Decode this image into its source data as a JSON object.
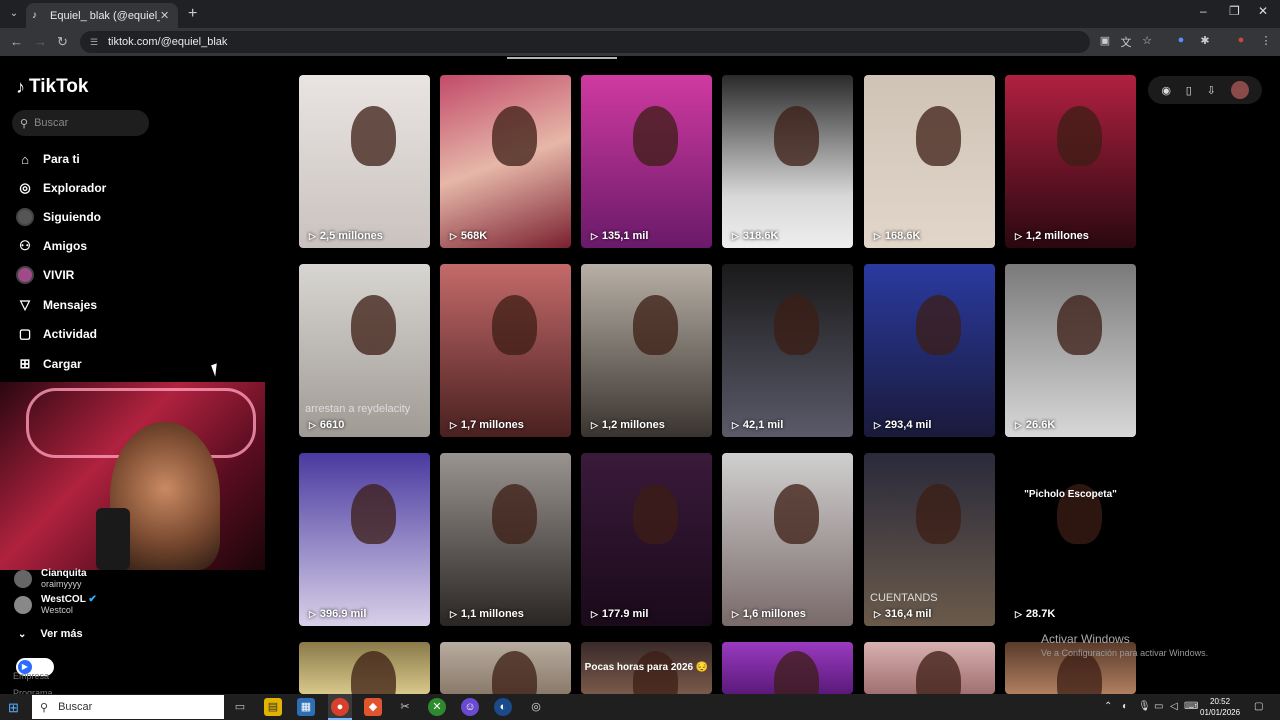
{
  "browser": {
    "tab_title": "Equiel_ blak (@equiel_.blak) | Ti",
    "url": "tiktok.com/@equiel_blak",
    "new_tab": "+",
    "tab_close": "✕",
    "win_minimize": "–",
    "win_restore": "❐",
    "win_close": "✕"
  },
  "sidebar": {
    "logo": "TikTok",
    "search_placeholder": "Buscar",
    "menu": [
      {
        "label": "Para ti",
        "icon": "home-icon"
      },
      {
        "label": "Explorador",
        "icon": "compass-icon"
      },
      {
        "label": "Siguiendo",
        "icon": "following-avatar"
      },
      {
        "label": "Amigos",
        "icon": "friends-icon"
      },
      {
        "label": "VIVIR",
        "icon": "live-avatar"
      },
      {
        "label": "Mensajes",
        "icon": "send-icon"
      },
      {
        "label": "Actividad",
        "icon": "activity-icon"
      },
      {
        "label": "Cargar",
        "icon": "upload-icon"
      }
    ],
    "following": [
      {
        "name": "Cianquita",
        "handle": "oraimyyyy"
      },
      {
        "name": "WestCOL",
        "handle": "Westcol"
      }
    ],
    "ver_mas": "Ver más",
    "footer_1": "Empresa",
    "footer_2": "Programa"
  },
  "grid": {
    "rows": [
      [
        {
          "views": "2,5 millones",
          "bg": "linear-gradient(180deg,#e9e4e2,#c9c2bf)"
        },
        {
          "views": "568K",
          "bg": "linear-gradient(160deg,#c24a6a,#e6b7a8,#7a2030)"
        },
        {
          "views": "135,1 mil",
          "bg": "linear-gradient(180deg,#d03aa0,#6a1a6a)"
        },
        {
          "views": "318.6K",
          "bg": "linear-gradient(180deg,#2a2a2a,#d8d8d8 70%,#eee)"
        },
        {
          "views": "168.6K",
          "bg": "linear-gradient(180deg,#cfc3b6,#e2d6cb)"
        },
        {
          "views": "1,2 millones",
          "bg": "linear-gradient(180deg,#b02040,#2a0810)"
        }
      ],
      [
        {
          "views": "6610",
          "bg": "linear-gradient(180deg,#d8d6d2,#a09a94)",
          "overlay": "arrestan a reydelacity"
        },
        {
          "views": "1,7 millones",
          "bg": "linear-gradient(180deg,#c46a6a,#4a2020)"
        },
        {
          "views": "1,2 millones",
          "bg": "linear-gradient(180deg,#b8b0a6,#3a3430)"
        },
        {
          "views": "42,1 mil",
          "bg": "linear-gradient(180deg,#1a1a1a,#5a5a6a)"
        },
        {
          "views": "293,4 mil",
          "bg": "linear-gradient(180deg,#2a3aa0,#1a1a3a)"
        },
        {
          "views": "26.6K",
          "bg": "linear-gradient(180deg,#7a7a7a,#d8d8d8)"
        }
      ],
      [
        {
          "views": "396.9 mil",
          "bg": "linear-gradient(180deg,#4a3aa0,#d8d0e8)"
        },
        {
          "views": "1,1 millones",
          "bg": "linear-gradient(180deg,#9a9490,#2a2624)"
        },
        {
          "views": "177.9 mil",
          "bg": "linear-gradient(180deg,#3a1a3a,#1a0a1a)"
        },
        {
          "views": "1,6 millones",
          "bg": "linear-gradient(180deg,#d0cfcf,#7a6a6a)"
        },
        {
          "views": "316,4 mil",
          "bg": "linear-gradient(180deg,#2a2a3a,#6a5a4a)",
          "overlay": "CUENTANDS"
        },
        {
          "views": "28.7K",
          "bg": "#000",
          "caption": "\"Picholo Escopeta\""
        }
      ],
      [
        {
          "views": "",
          "bg": "linear-gradient(180deg,#8a7a4a,#d8c88a)"
        },
        {
          "views": "",
          "bg": "linear-gradient(180deg,#b8aca0,#8a7a6a)"
        },
        {
          "views": "",
          "bg": "linear-gradient(180deg,#3a2a2a,#7a5a4a)",
          "caption": "Pocas horas para 2026 😔"
        },
        {
          "views": "",
          "bg": "linear-gradient(180deg,#9a3ac0,#5a1a7a)"
        },
        {
          "views": "",
          "bg": "linear-gradient(180deg,#d8b0b0,#a07070)"
        },
        {
          "views": "",
          "bg": "linear-gradient(180deg,#5a3a2a,#b08060)"
        }
      ]
    ]
  },
  "watermark": {
    "title": "Activar Windows",
    "sub": "Ve a Configuración para activar Windows."
  },
  "taskbar": {
    "search": "Buscar",
    "time": "20:52",
    "date": "01/01/2026"
  }
}
